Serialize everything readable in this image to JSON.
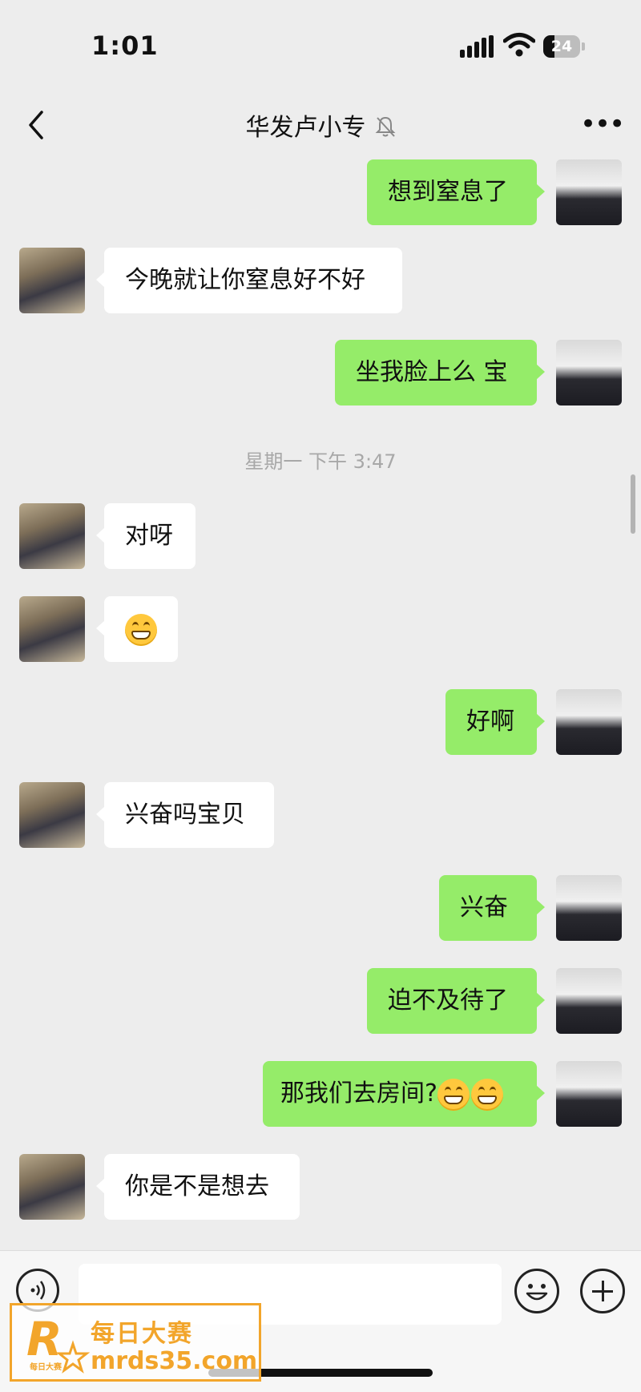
{
  "status_bar": {
    "time": "1:01",
    "battery": "24"
  },
  "nav": {
    "title": "华发卢小专"
  },
  "timestamp": "星期一 下午 3:47",
  "messages": [
    {
      "side": "right",
      "text": "想到窒息了"
    },
    {
      "side": "left",
      "text": "今晚就让你窒息好不好"
    },
    {
      "side": "right",
      "text": "坐我脸上么 宝"
    },
    {
      "side": "left",
      "text": "对呀"
    },
    {
      "side": "left",
      "text": "",
      "emoji": "grin-emoji"
    },
    {
      "side": "right",
      "text": "好啊"
    },
    {
      "side": "left",
      "text": "兴奋吗宝贝"
    },
    {
      "side": "right",
      "text": "兴奋"
    },
    {
      "side": "right",
      "text": "迫不及待了"
    },
    {
      "side": "right",
      "text": "那我们去房间?",
      "emoji": "grin-emoji x2"
    },
    {
      "side": "left",
      "text": "你是不是想去"
    }
  ],
  "input_bar": {
    "placeholder": "",
    "icons": [
      "voice-icon",
      "emoji-icon",
      "plus-icon"
    ]
  },
  "watermark": {
    "logo_letter": "R",
    "logo_sub": "每日大赛",
    "cn": "每日大赛",
    "url": "mrds35.com"
  },
  "colors": {
    "background": "#ededed",
    "sent_bubble": "#95ec69",
    "received_bubble": "#ffffff",
    "watermark": "#f2a52b"
  }
}
